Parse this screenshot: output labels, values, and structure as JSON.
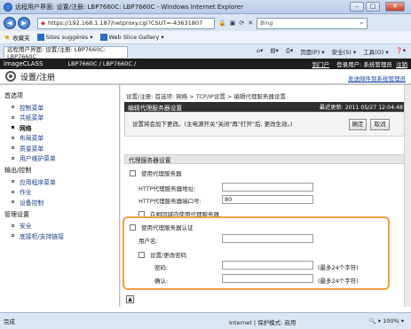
{
  "window": {
    "title": "远程用户界面: 设置/注册: LBP7660C: LBP7660C - Windows Internet Explorer",
    "minimize": "–",
    "maximize": "□",
    "close": "✕"
  },
  "browser": {
    "url": "https://192.168.1.187/netproxy.cgi?CSUT=-43631807",
    "search_placeholder": "Bing",
    "favorites_label": "收藏夹",
    "fav_items": [
      "Sites suggérés ▾",
      "Web Slice Gallery ▾"
    ],
    "tab_title": "远程用户界面: 设置/注册: LBP7660C: LBP7660C",
    "cmd": [
      "页面(P) ▾",
      "安全(S) ▾",
      "工具(O) ▾",
      "❓▾"
    ]
  },
  "header": {
    "brand": "imageCLASS",
    "model": "LBP7660C / LBP7660C /",
    "portal": "到门户",
    "login_user": "登录用户: 系统管理员",
    "logout": "注销",
    "page_title": "设置/注册",
    "mail_link": "发送邮件到系统管理员"
  },
  "sidebar": {
    "sections": [
      {
        "title": "首选项",
        "items": [
          {
            "label": "控制菜单",
            "active": false
          },
          {
            "label": "共纸菜单",
            "active": false
          },
          {
            "label": "网络",
            "active": true
          },
          {
            "label": "布局菜单",
            "active": false
          },
          {
            "label": "质量菜单",
            "active": false
          },
          {
            "label": "用户维护菜单",
            "active": false
          }
        ]
      },
      {
        "title": "输出/控制",
        "items": [
          {
            "label": "应用程序菜单",
            "active": false
          },
          {
            "label": "作业",
            "active": false
          },
          {
            "label": "设备控制",
            "active": false
          }
        ]
      },
      {
        "title": "管理设置",
        "items": [
          {
            "label": "安全",
            "active": false
          },
          {
            "label": "底接柜/支持链接",
            "active": false
          }
        ]
      }
    ]
  },
  "main": {
    "breadcrumb": "设置/注册: 首选项: 网络 > TCP/IP设置 > 编辑代理服务器设置",
    "panel_title": "编辑代理服务器设置",
    "last_updated": "最近更新: 2011 05/27 12:04:48",
    "message": "设置将会加下更改。(主电源开关\"关闭\"再\"打开\"后, 更改生效。)",
    "ok_label": "确定",
    "cancel_label": "取消",
    "section_title": "代理服务器设置",
    "use_proxy_label": "使用代理服务器",
    "proxy_address_label": "HTTP代理服务器地址:",
    "proxy_address_value": "",
    "proxy_port_label": "HTTP代理服务器端口号:",
    "proxy_port_value": "80",
    "same_domain_label": "在相同域内使用代理服务器",
    "use_auth_label": "使用代理服务器认证",
    "username_label": "用户名:",
    "username_value": "",
    "set_password_label": "设置/更改密码",
    "password_label": "密码:",
    "password_hint": "(最多24个字符)",
    "confirm_label": "确认:",
    "confirm_hint": "(最多24个字符)",
    "top_icon": "up-arrow-icon"
  },
  "status": {
    "left": "完成",
    "zone": "Internet | 保护模式: 启用",
    "zoom": "🔍 ▾  100%  ▾"
  },
  "colors": {
    "highlight": "#f0a040",
    "link": "#1846a8",
    "brand_bg": "#1e1e1e"
  }
}
